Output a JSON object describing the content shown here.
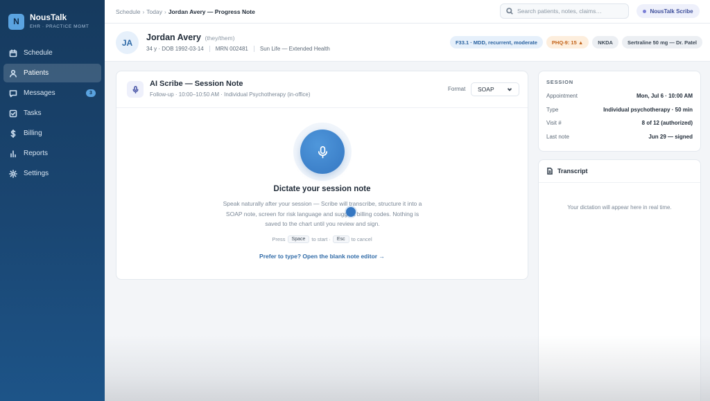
{
  "brand": {
    "logo": "N",
    "name": "NousTalk",
    "subtitle": "EHR · PRACTICE MGMT"
  },
  "sidebar": {
    "items": [
      {
        "label": "Schedule",
        "icon": "calendar-icon"
      },
      {
        "label": "Patients",
        "icon": "user-icon",
        "active": true
      },
      {
        "label": "Messages",
        "icon": "message-icon",
        "badge": "3"
      },
      {
        "label": "Tasks",
        "icon": "checkbox-icon"
      },
      {
        "label": "Billing",
        "icon": "dollar-icon"
      },
      {
        "label": "Reports",
        "icon": "bar-chart-icon"
      },
      {
        "label": "Settings",
        "icon": "gear-icon"
      }
    ]
  },
  "topbar": {
    "breadcrumb": [
      "Schedule",
      "Today",
      "Jordan Avery — Progress Note"
    ],
    "search_placeholder": "Search patients, notes, claims…",
    "scribe_label": "NousTalk Scribe"
  },
  "patient": {
    "initials": "JA",
    "name": "Jordan Avery",
    "pronouns": "(they/them)",
    "age_dob": "34 y · DOB 1992-03-14",
    "mrn": "MRN 002481",
    "insurance": "Sun Life — Extended Health",
    "tags": {
      "diagnosis": "F33.1 · MDD, recurrent, moderate",
      "phq": "PHQ-9: 15 ▲",
      "allergy": "NKDA",
      "medication": "Sertraline 50 mg — Dr. Patel"
    }
  },
  "note": {
    "title": "AI Scribe — Session Note",
    "subtitle": "Follow-up · 10:00–10:50 AM · Individual Psychotherapy (in-office)",
    "format_label": "Format",
    "format_value": "SOAP",
    "dictate_title": "Dictate your session note",
    "dictate_desc": "Speak naturally after your session — Scribe will transcribe, structure it into a SOAP note, screen for risk language and suggest billing codes. Nothing is saved to the chart until you review and sign.",
    "hint_press": "Press",
    "hint_key_start": "Space",
    "hint_to_start": "to start ·",
    "hint_key_cancel": "Esc",
    "hint_to_cancel": "to cancel",
    "blank_link": "Prefer to type? Open the blank note editor →"
  },
  "session": {
    "heading": "SESSION",
    "rows": [
      {
        "key": "Appointment",
        "value": "Mon, Jul 6 · 10:00 AM"
      },
      {
        "key": "Type",
        "value": "Individual psychotherapy · 50 min"
      },
      {
        "key": "Visit #",
        "value": "8 of 12 (authorized)"
      },
      {
        "key": "Last note",
        "value": "Jun 29 — signed"
      }
    ]
  },
  "transcript": {
    "heading": "Transcript",
    "empty": "Your dictation will appear here in real time."
  },
  "colors": {
    "accent": "#3577c2",
    "sidebar": "#1a4672",
    "phq_warning": "#c2631a"
  }
}
